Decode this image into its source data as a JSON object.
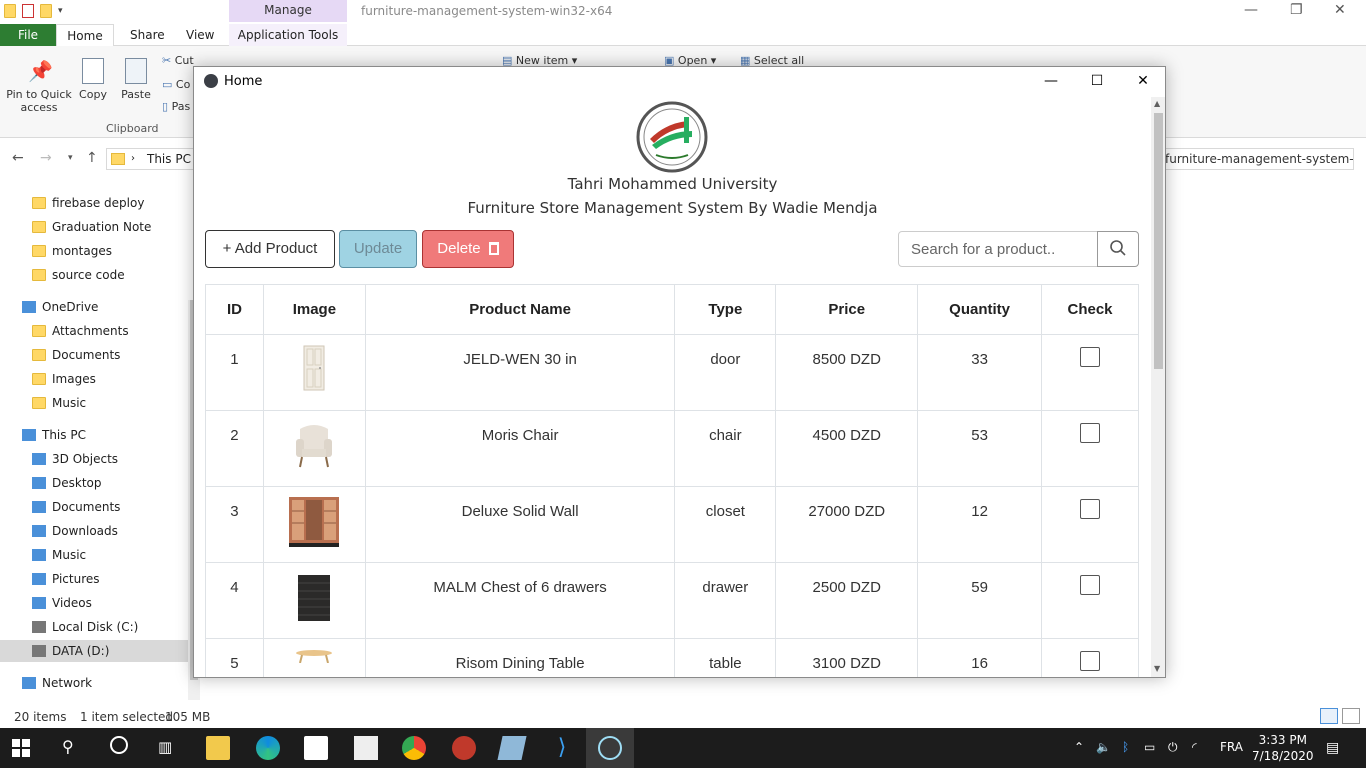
{
  "explorer": {
    "manage_tab": "Manage",
    "window_title": "furniture-management-system-win32-x64",
    "ribbon_tabs": {
      "file": "File",
      "home": "Home",
      "share": "Share",
      "view": "View",
      "app_tools": "Application Tools"
    },
    "ribbon": {
      "pin": "Pin to Quick access",
      "copy": "Copy",
      "paste": "Paste",
      "cut": "Cut",
      "copy_path": "Co",
      "paste_shortcut": "Pas",
      "new_item": "New item ▾",
      "open": "Open ▾",
      "select_all": "Select all",
      "clipboard_label": "Clipboard"
    },
    "address": {
      "current": "This PC",
      "right_path": "furniture-management-system-wi..."
    },
    "nav_items": [
      {
        "label": "firebase deploy",
        "icon": "folder-icon"
      },
      {
        "label": "Graduation Note",
        "icon": "folder-icon"
      },
      {
        "label": "montages",
        "icon": "folder-icon"
      },
      {
        "label": "source code",
        "icon": "folder-icon"
      },
      {
        "label": "OneDrive",
        "icon": "cloud-icon"
      },
      {
        "label": "Attachments",
        "icon": "folder-icon"
      },
      {
        "label": "Documents",
        "icon": "folder-icon"
      },
      {
        "label": "Images",
        "icon": "folder-icon"
      },
      {
        "label": "Music",
        "icon": "folder-icon"
      },
      {
        "label": "This PC",
        "icon": "computer-icon"
      },
      {
        "label": "3D Objects",
        "icon": "cube-icon"
      },
      {
        "label": "Desktop",
        "icon": "desktop-icon"
      },
      {
        "label": "Documents",
        "icon": "document-icon"
      },
      {
        "label": "Downloads",
        "icon": "download-icon"
      },
      {
        "label": "Music",
        "icon": "music-icon"
      },
      {
        "label": "Pictures",
        "icon": "picture-icon"
      },
      {
        "label": "Videos",
        "icon": "video-icon"
      },
      {
        "label": "Local Disk (C:)",
        "icon": "disk-icon"
      },
      {
        "label": "DATA (D:)",
        "icon": "disk-icon"
      },
      {
        "label": "Network",
        "icon": "network-icon"
      }
    ],
    "status": {
      "items": "20 items",
      "selected": "1 item selected",
      "size": "105 MB"
    }
  },
  "taskbar": {
    "language": "FRA",
    "time": "3:33 PM",
    "date": "7/18/2020"
  },
  "app": {
    "window_title": "Home",
    "university": "Tahri Mohammed University",
    "subtitle": "Furniture Store Management System By Wadie Mendja",
    "buttons": {
      "add": "+ Add Product",
      "update": "Update",
      "delete": "Delete"
    },
    "search_placeholder": "Search for a product..",
    "columns": [
      "ID",
      "Image",
      "Product Name",
      "Type",
      "Price",
      "Quantity",
      "Check"
    ],
    "products": [
      {
        "id": "1",
        "image": "door-image",
        "name": "JELD-WEN 30 in",
        "type": "door",
        "price": "8500 DZD",
        "quantity": "33",
        "checked": false
      },
      {
        "id": "2",
        "image": "chair-image",
        "name": "Moris Chair",
        "type": "chair",
        "price": "4500 DZD",
        "quantity": "53",
        "checked": false
      },
      {
        "id": "3",
        "image": "closet-image",
        "name": "Deluxe Solid Wall",
        "type": "closet",
        "price": "27000 DZD",
        "quantity": "12",
        "checked": false
      },
      {
        "id": "4",
        "image": "drawer-image",
        "name": "MALM Chest of 6 drawers",
        "type": "drawer",
        "price": "2500 DZD",
        "quantity": "59",
        "checked": false
      },
      {
        "id": "5",
        "image": "table-image",
        "name": "Risom Dining Table",
        "type": "table",
        "price": "3100 DZD",
        "quantity": "16",
        "checked": false
      }
    ],
    "colors": {
      "update_bg": "#9fd3e3",
      "delete_bg": "#f07a7a",
      "table_border": "#dee2e6"
    }
  }
}
